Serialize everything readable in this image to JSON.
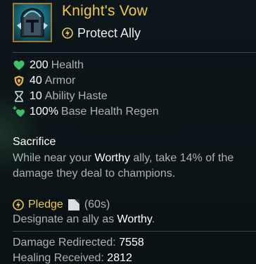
{
  "item": {
    "name": "Knight's Vow",
    "icon": "knights-vow-helmet-icon"
  },
  "passive": {
    "icon": "lightning-bolt-icon",
    "label": "Protect Ally"
  },
  "stats": [
    {
      "icon": "heart-icon",
      "value": "200",
      "label": "Health"
    },
    {
      "icon": "shield-icon",
      "value": "40",
      "label": "Armor"
    },
    {
      "icon": "hourglass-icon",
      "value": "10",
      "label": "Ability Haste"
    },
    {
      "icon": "health-regen-icon",
      "value": "100%",
      "label": "Base Health Regen"
    }
  ],
  "sacrifice": {
    "title": "Sacrifice",
    "line1_pre": "While near your ",
    "line1_hl": "Worthy",
    "line1_post": " ally, take 14% of the",
    "line2": "damage they deal to champions."
  },
  "pledge": {
    "name": "Pledge",
    "cooldown": "(60s)",
    "desc_pre": "Designate an ally as ",
    "desc_hl": "Worthy",
    "desc_post": "."
  },
  "trackers": [
    {
      "label": "Damage Redirected: ",
      "value": "7558"
    },
    {
      "label": "Healing Received: ",
      "value": "2812"
    }
  ],
  "colors": {
    "item_name": "#f0c94a",
    "stat_value": "#ffffff",
    "stat_label": "#a8b4b4",
    "heart": "#3fbf6a",
    "armor": "#e8b043"
  }
}
